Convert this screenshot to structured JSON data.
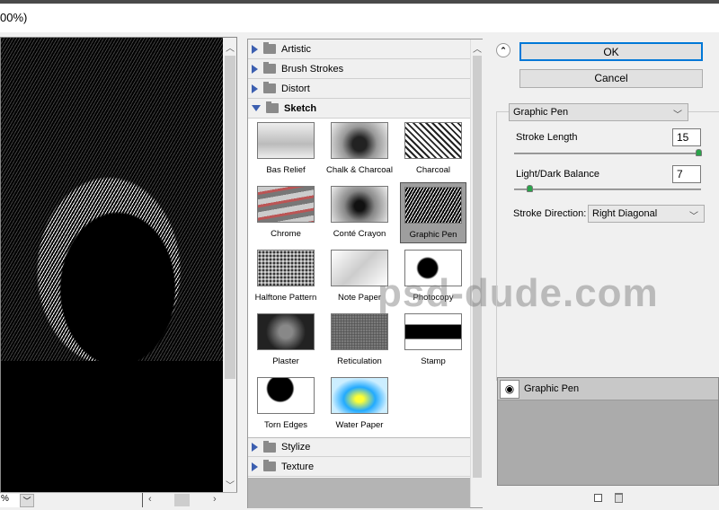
{
  "window": {
    "title_fragment": "00%)"
  },
  "preview": {
    "zoom_value": "%"
  },
  "filter_categories": {
    "top": [
      {
        "label": "Artistic"
      },
      {
        "label": "Brush Strokes"
      },
      {
        "label": "Distort"
      }
    ],
    "expanded": {
      "label": "Sketch"
    },
    "bottom": [
      {
        "label": "Stylize"
      },
      {
        "label": "Texture"
      }
    ]
  },
  "sketch_filters": [
    {
      "label": "Bas Relief"
    },
    {
      "label": "Chalk & Charcoal"
    },
    {
      "label": "Charcoal"
    },
    {
      "label": "Chrome"
    },
    {
      "label": "Conté Crayon"
    },
    {
      "label": "Graphic Pen",
      "selected": true
    },
    {
      "label": "Halftone Pattern"
    },
    {
      "label": "Note Paper"
    },
    {
      "label": "Photocopy"
    },
    {
      "label": "Plaster"
    },
    {
      "label": "Reticulation"
    },
    {
      "label": "Stamp"
    },
    {
      "label": "Torn Edges"
    },
    {
      "label": "Water Paper"
    }
  ],
  "watermark": "psd-dude.com",
  "buttons": {
    "ok": "OK",
    "cancel": "Cancel"
  },
  "settings": {
    "filter_select": "Graphic Pen",
    "stroke_length": {
      "label": "Stroke Length",
      "value": "15",
      "fraction": 1.0
    },
    "balance": {
      "label": "Light/Dark Balance",
      "value": "7",
      "fraction": 0.07
    },
    "stroke_direction": {
      "label": "Stroke Direction:",
      "value": "Right Diagonal"
    }
  },
  "layers": [
    {
      "label": "Graphic Pen",
      "icon": "eye-icon"
    }
  ],
  "colors": {
    "ok_border": "#0078d7",
    "slider_knob": "#2aa44a",
    "selected_thumb": "#9e9e9e"
  }
}
